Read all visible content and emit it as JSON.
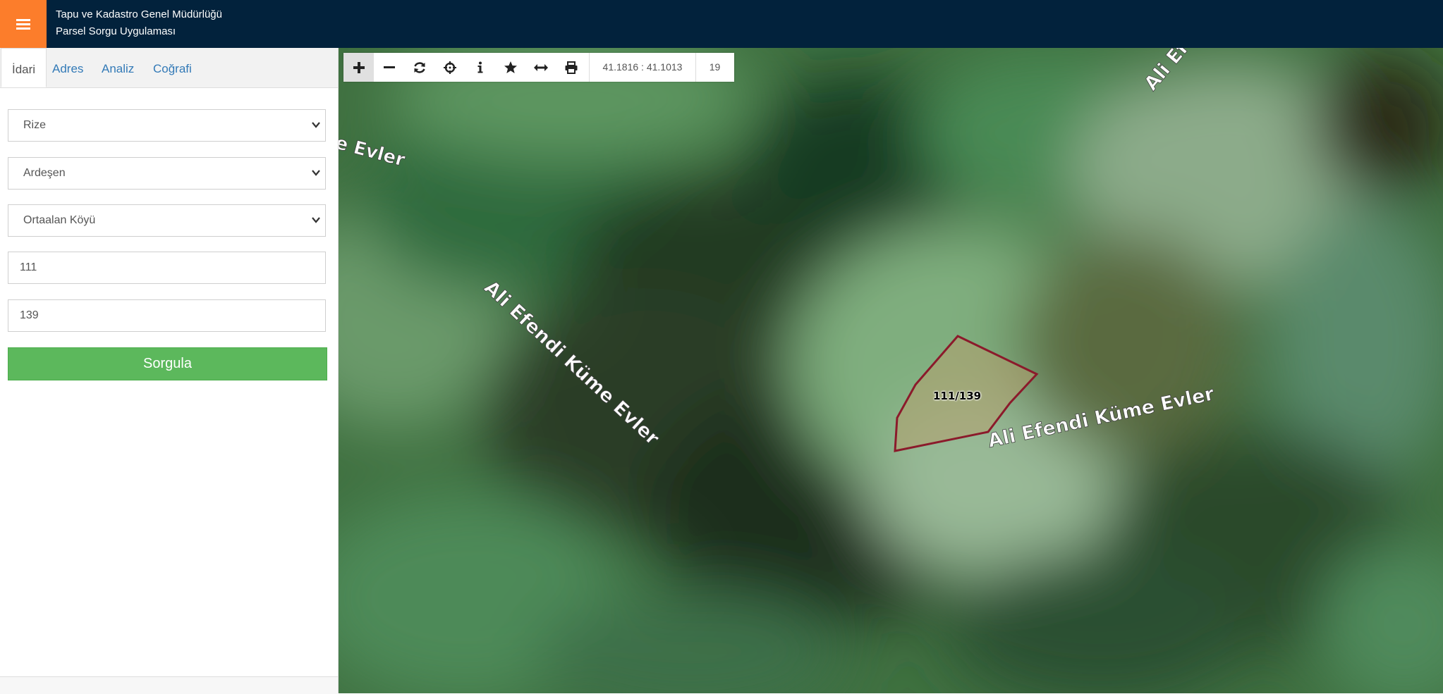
{
  "header": {
    "title_line1": "Tapu ve Kadastro Genel Müdürlüğü",
    "title_line2": "Parsel Sorgu Uygulaması",
    "menu_icon": "hamburger-icon",
    "accent_color": "#fc7d2b",
    "bar_color": "#02223c"
  },
  "sidebar": {
    "tabs": [
      {
        "label": "İdari",
        "active": true
      },
      {
        "label": "Adres",
        "active": false
      },
      {
        "label": "Analiz",
        "active": false
      },
      {
        "label": "Coğrafi",
        "active": false
      }
    ],
    "province_select": {
      "value": "Rize"
    },
    "district_select": {
      "value": "Ardeşen"
    },
    "neighborhood_select": {
      "value": "Ortaalan Köyü"
    },
    "block_input": {
      "value": "111"
    },
    "parcel_input": {
      "value": "139"
    },
    "submit_label": "Sorgula",
    "submit_color": "#5cb85c"
  },
  "map": {
    "toolbar": {
      "buttons": [
        "zoom-in-icon",
        "zoom-out-icon",
        "refresh-icon",
        "locate-icon",
        "info-icon",
        "star-icon",
        "measure-icon",
        "print-icon"
      ],
      "coordinates": "41.1816 : 41.1013",
      "zoom_level": "19"
    },
    "street_labels": [
      "e Evler",
      "Ali Efendi Küme Evler",
      "Ali Efendi Küme Evler",
      "Ali Ef"
    ],
    "parcel_label": "111/139",
    "parcel_outline_color": "#8b1a2b"
  }
}
